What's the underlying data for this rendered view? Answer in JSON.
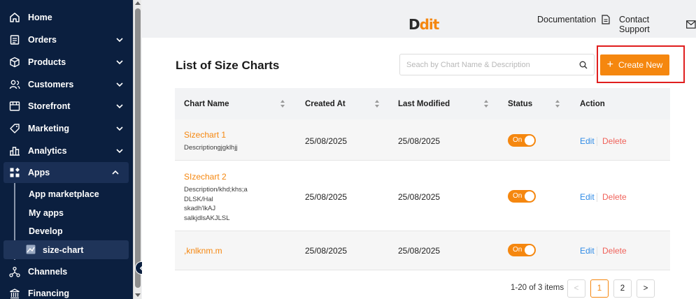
{
  "sidebar": {
    "items": [
      {
        "label": "Home",
        "icon": "home-icon"
      },
      {
        "label": "Orders",
        "icon": "orders-icon"
      },
      {
        "label": "Products",
        "icon": "products-icon"
      },
      {
        "label": "Customers",
        "icon": "customers-icon"
      },
      {
        "label": "Storefront",
        "icon": "storefront-icon"
      },
      {
        "label": "Marketing",
        "icon": "marketing-icon"
      },
      {
        "label": "Analytics",
        "icon": "analytics-icon"
      },
      {
        "label": "Apps",
        "icon": "apps-icon"
      },
      {
        "label": "Channels",
        "icon": "channels-icon"
      },
      {
        "label": "Financing",
        "icon": "financing-icon"
      }
    ],
    "apps_sub": [
      {
        "label": "App marketplace"
      },
      {
        "label": "My apps"
      },
      {
        "label": "Develop"
      },
      {
        "label": "size-chart"
      }
    ]
  },
  "topbar": {
    "logo_main": "D",
    "logo_accent": "dit",
    "documentation": "Documentation",
    "contact_support": "Contact Support"
  },
  "page": {
    "title": "List of Size Charts",
    "search_placeholder": "Seach by Chart Name & Description",
    "create_label": "Create New",
    "create_icon": "plus-icon"
  },
  "table": {
    "columns": [
      "Chart Name",
      "Created At",
      "Last Modified",
      "Status",
      "Action"
    ],
    "rows": [
      {
        "name": "Sizechart 1",
        "description": "Descriptiongjgklhjj",
        "created": "25/08/2025",
        "modified": "25/08/2025",
        "status": "On",
        "edit": "Edit",
        "delete": "Delete"
      },
      {
        "name": "SIzechart 2",
        "description": "Description/khd;khs;a\nDLSK/Hal\nskadh'lkAJ\nsalkjdlsAKJLSL",
        "created": "25/08/2025",
        "modified": "25/08/2025",
        "status": "On",
        "edit": "Edit",
        "delete": "Delete"
      },
      {
        "name": ",knlknm.m",
        "description": "",
        "created": "25/08/2025",
        "modified": "25/08/2025",
        "status": "On",
        "edit": "Edit",
        "delete": "Delete"
      }
    ]
  },
  "pagination": {
    "info": "1-20 of 3 items",
    "pages": [
      "1",
      "2"
    ],
    "current": "1",
    "prev": "<",
    "next": ">"
  },
  "colors": {
    "accent": "#f5870f",
    "sidebar_bg": "#0b1f3f",
    "link_blue": "#2f8be6",
    "delete_red": "#f0625a",
    "highlight": "#e01e1e"
  }
}
